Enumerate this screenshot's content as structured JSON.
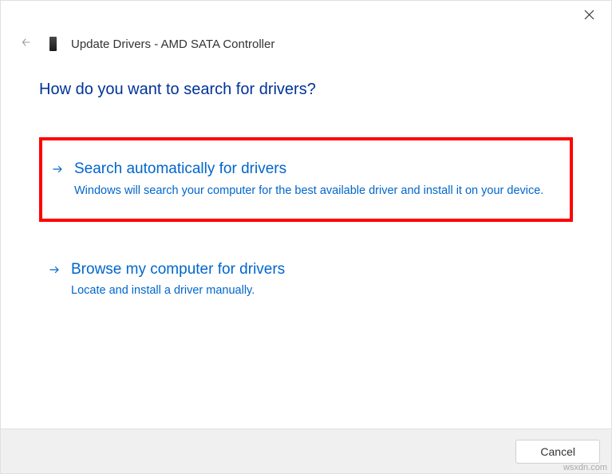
{
  "header": {
    "window_title": "Update Drivers - AMD SATA Controller"
  },
  "content": {
    "question": "How do you want to search for drivers?",
    "options": [
      {
        "title": "Search automatically for drivers",
        "description": "Windows will search your computer for the best available driver and install it on your device."
      },
      {
        "title": "Browse my computer for drivers",
        "description": "Locate and install a driver manually."
      }
    ]
  },
  "footer": {
    "cancel_label": "Cancel"
  },
  "watermark": "wsxdn.com"
}
